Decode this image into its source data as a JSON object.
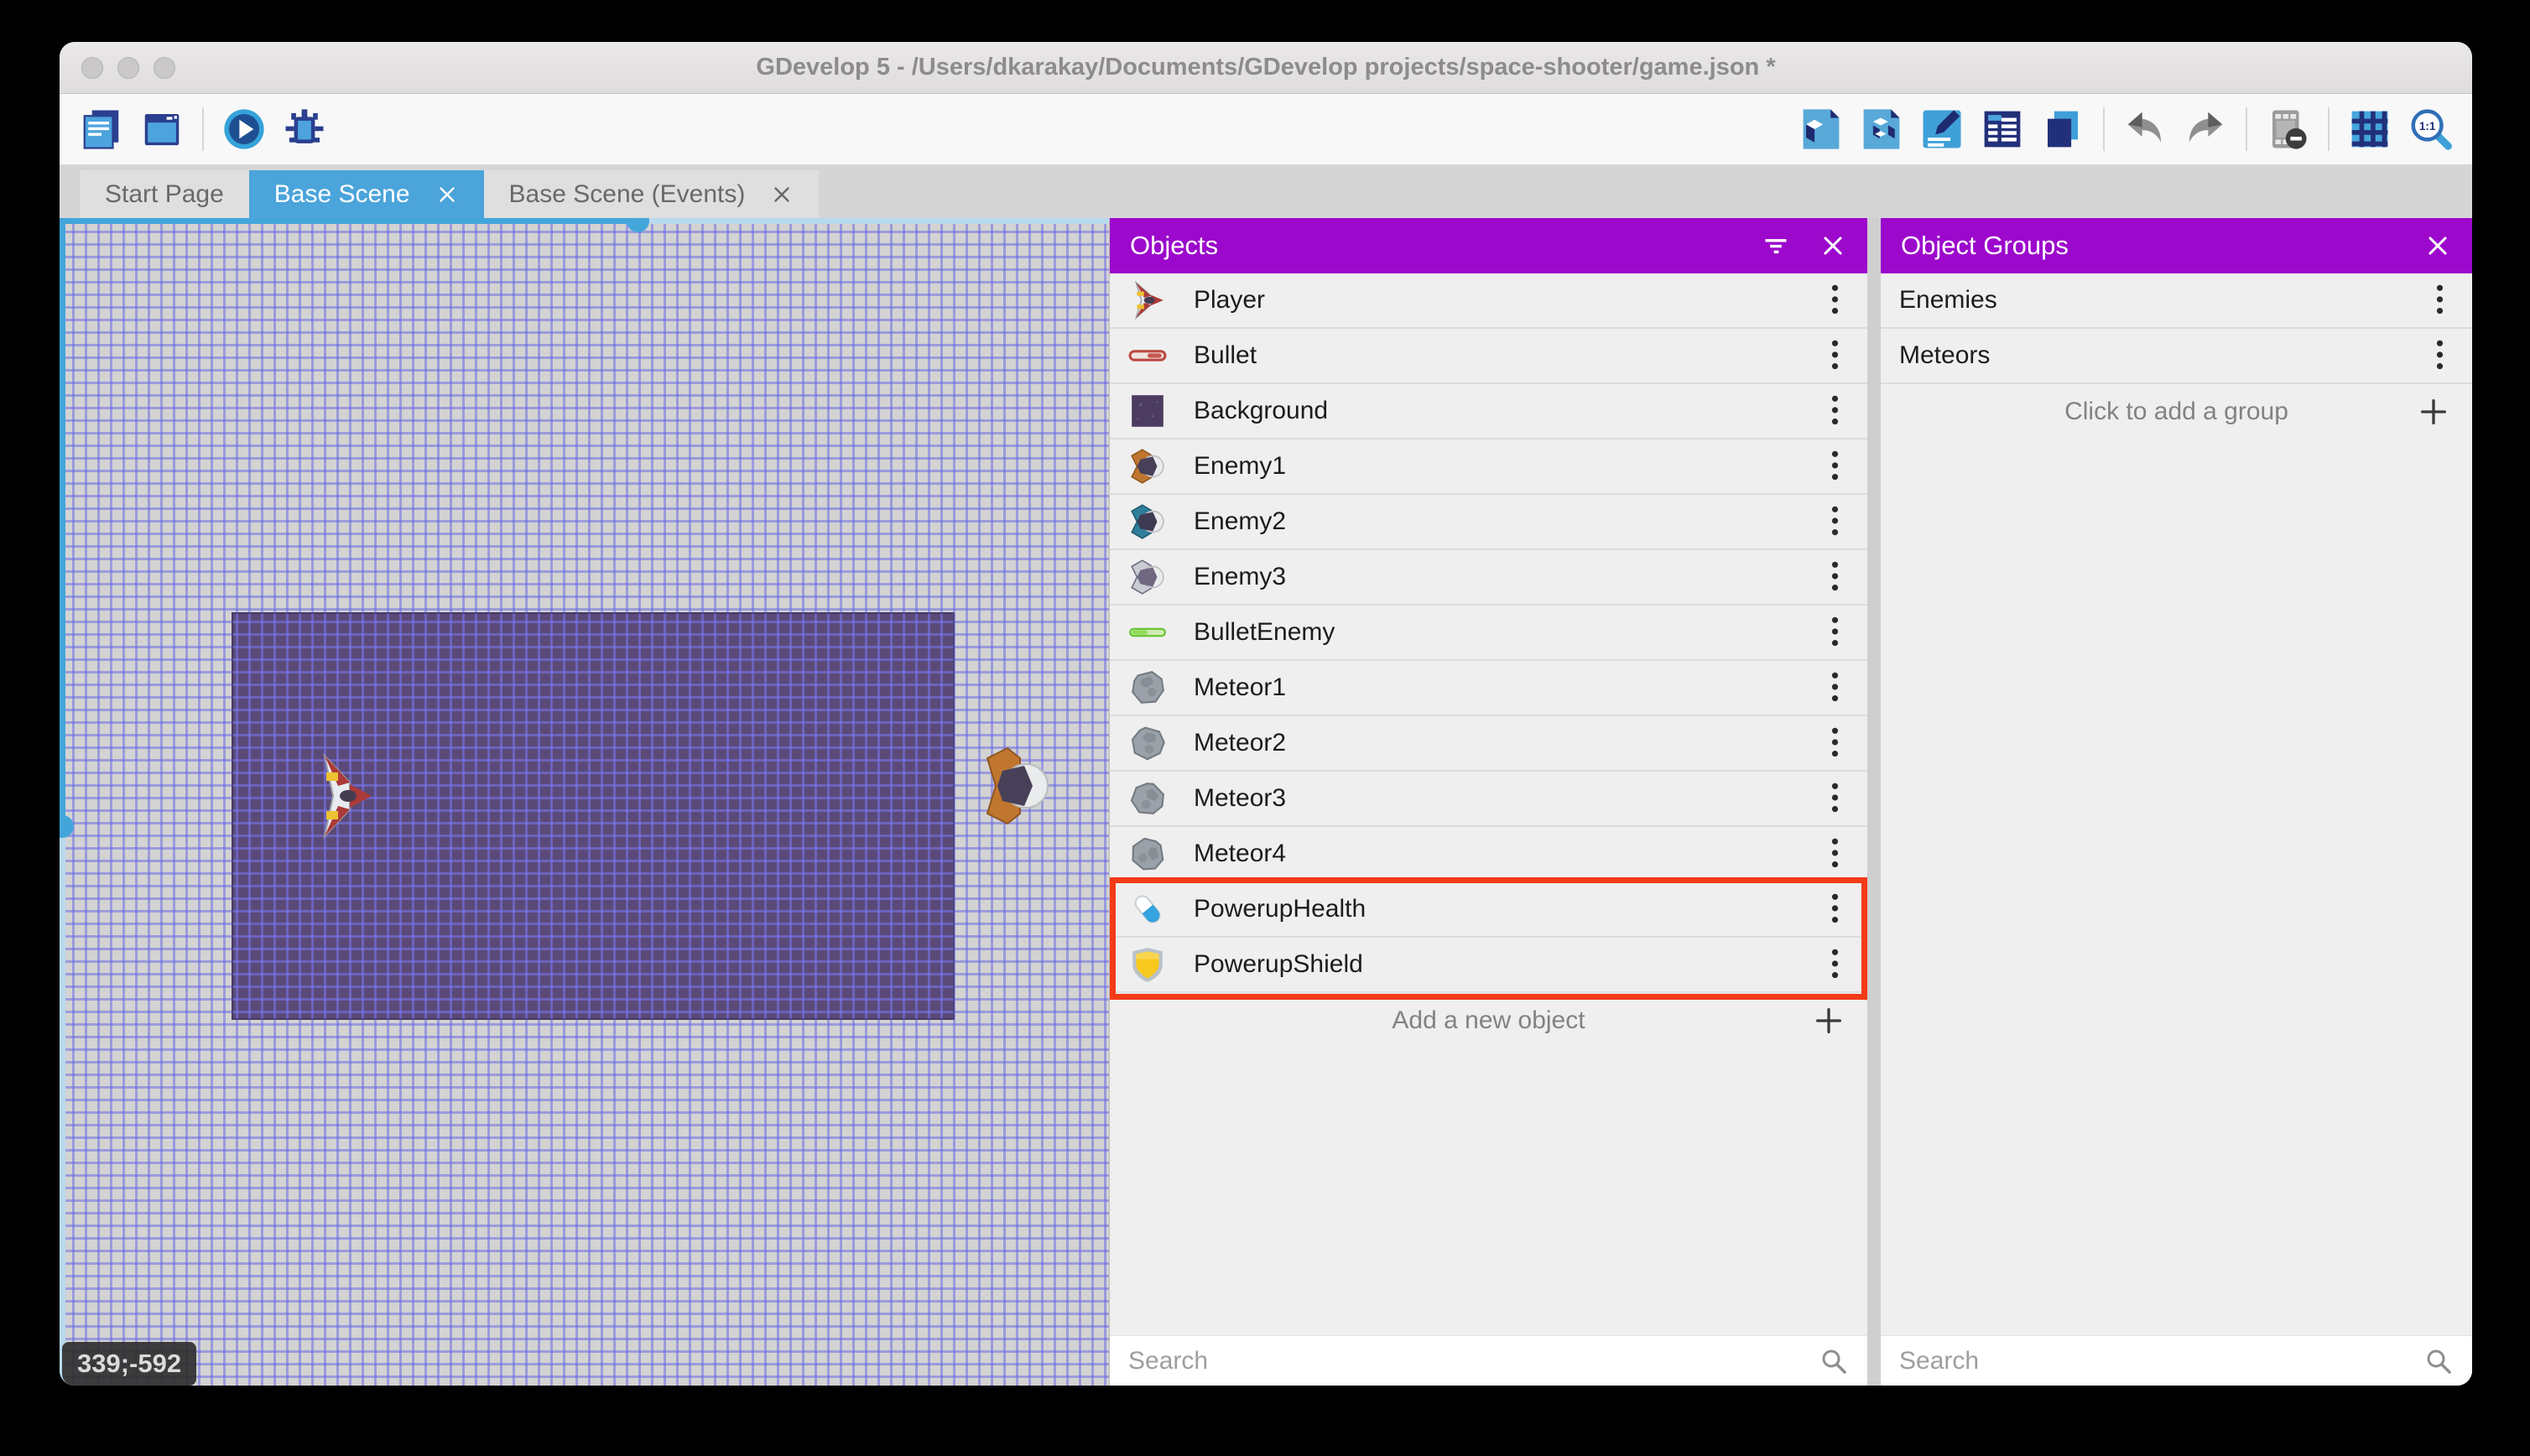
{
  "window": {
    "title": "GDevelop 5 - /Users/dkarakay/Documents/GDevelop projects/space-shooter/game.json *"
  },
  "toolbar": {
    "left": [
      {
        "name": "project-manager-icon",
        "icon": "project-manager"
      },
      {
        "name": "start-page-icon",
        "icon": "start-page"
      },
      {
        "type": "divider"
      },
      {
        "name": "preview-play-icon",
        "icon": "play"
      },
      {
        "name": "debug-icon",
        "icon": "debug"
      }
    ],
    "right": [
      {
        "name": "objects-panel-icon",
        "icon": "objects-list"
      },
      {
        "name": "object-groups-panel-icon",
        "icon": "object-groups"
      },
      {
        "name": "scene-properties-icon",
        "icon": "scene-properties"
      },
      {
        "name": "instances-list-icon",
        "icon": "instances-list"
      },
      {
        "name": "layers-icon",
        "icon": "layers"
      },
      {
        "type": "divider"
      },
      {
        "name": "undo-icon",
        "icon": "undo"
      },
      {
        "name": "redo-icon",
        "icon": "redo"
      },
      {
        "type": "divider"
      },
      {
        "name": "toggle-instances-mask-icon",
        "icon": "mask"
      },
      {
        "type": "divider"
      },
      {
        "name": "toggle-grid-icon",
        "icon": "grid"
      },
      {
        "name": "zoom-original-icon",
        "icon": "zoom-1-1"
      }
    ]
  },
  "tabs": [
    {
      "label": "Start Page",
      "active": false,
      "closable": false
    },
    {
      "label": "Base Scene",
      "active": true,
      "closable": true
    },
    {
      "label": "Base Scene (Events)",
      "active": false,
      "closable": true
    }
  ],
  "canvas": {
    "coordinates": "339;-592"
  },
  "objects_panel": {
    "title": "Objects",
    "items": [
      {
        "label": "Player",
        "icon": "player"
      },
      {
        "label": "Bullet",
        "icon": "bullet"
      },
      {
        "label": "Background",
        "icon": "background"
      },
      {
        "label": "Enemy1",
        "icon": "enemy1"
      },
      {
        "label": "Enemy2",
        "icon": "enemy2"
      },
      {
        "label": "Enemy3",
        "icon": "enemy3"
      },
      {
        "label": "BulletEnemy",
        "icon": "bullet-enemy"
      },
      {
        "label": "Meteor1",
        "icon": "meteor1"
      },
      {
        "label": "Meteor2",
        "icon": "meteor2"
      },
      {
        "label": "Meteor3",
        "icon": "meteor3"
      },
      {
        "label": "Meteor4",
        "icon": "meteor4"
      },
      {
        "label": "PowerupHealth",
        "icon": "powerup-health",
        "highlighted": true
      },
      {
        "label": "PowerupShield",
        "icon": "powerup-shield",
        "highlighted": true
      }
    ],
    "add_label": "Add a new object",
    "search_placeholder": "Search"
  },
  "groups_panel": {
    "title": "Object Groups",
    "items": [
      {
        "label": "Enemies"
      },
      {
        "label": "Meteors"
      }
    ],
    "add_label": "Click to add a group",
    "search_placeholder": "Search"
  },
  "colors": {
    "panel_header_purple": "#9c08cc",
    "active_tab_blue": "#4ba4da",
    "highlight_red": "#f43a17",
    "scrollbar_blue": "#42a6db",
    "canvas_gray": "#d3d3d3",
    "grid_line_blue": "#6464e6",
    "background_object_purple": "#5b4a78"
  }
}
